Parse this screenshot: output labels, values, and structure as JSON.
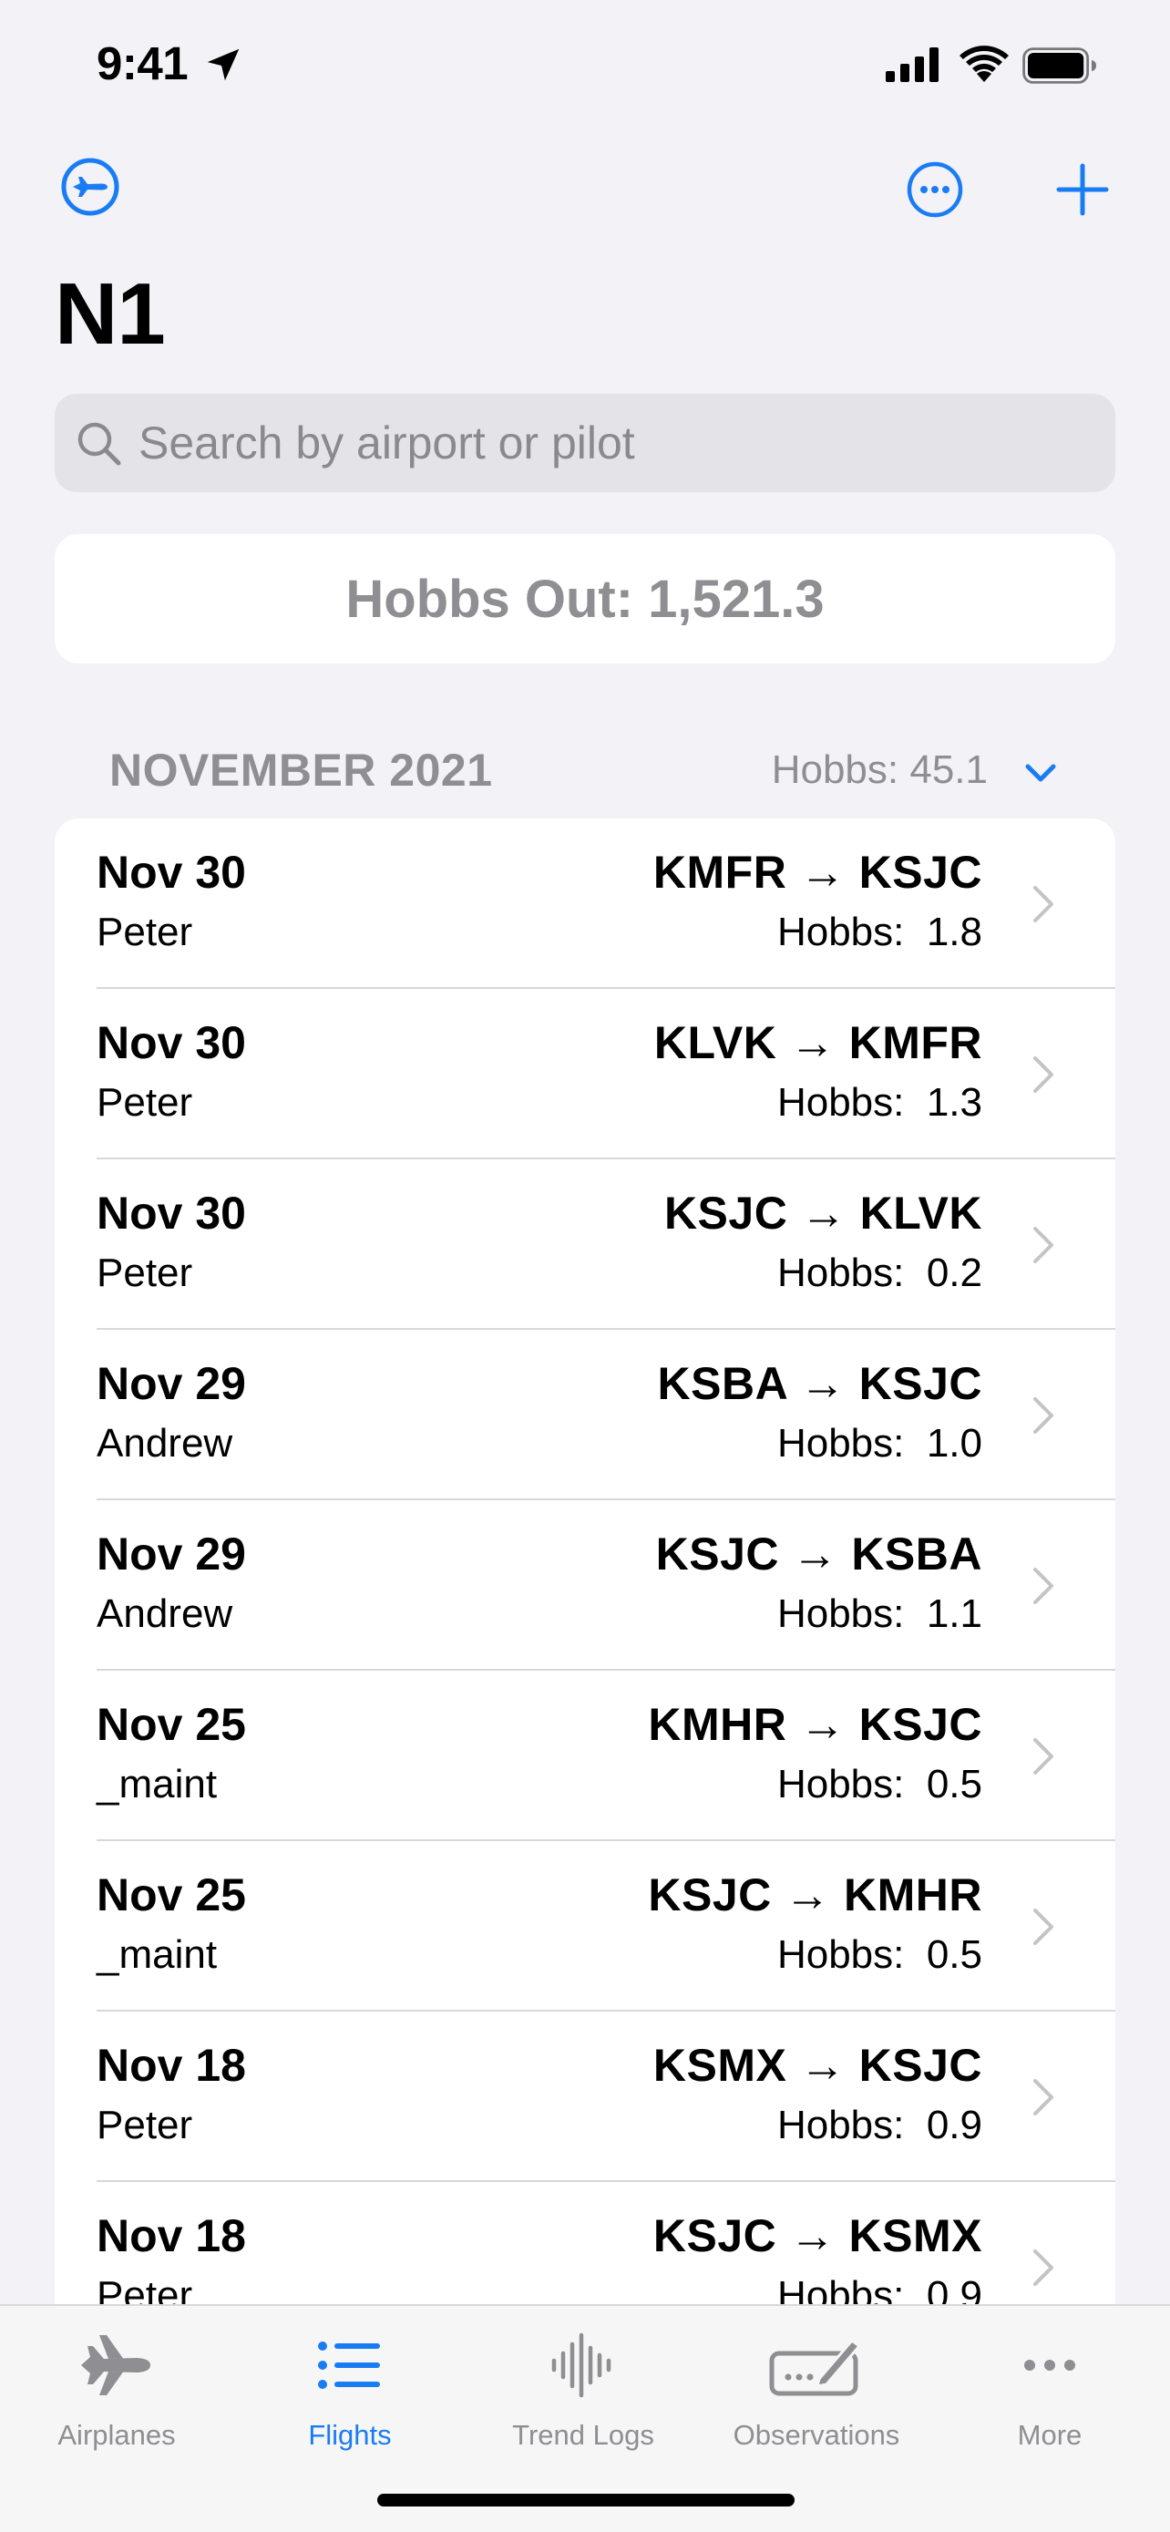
{
  "status_bar": {
    "time": "9:41"
  },
  "colors": {
    "accent": "#1a7cf3",
    "secondary_text": "#8e8e93",
    "background": "#f2f2f7"
  },
  "nav": {
    "title": "N1",
    "left_icon": "airplane-circle-icon",
    "more_icon": "ellipsis-circle-icon",
    "add_icon": "plus-icon"
  },
  "search": {
    "placeholder": "Search by airport or pilot",
    "value": ""
  },
  "hobbs_out": {
    "label": "Hobbs Out: 1,521.3"
  },
  "section": {
    "title": "NOVEMBER 2021",
    "hobbs": "Hobbs: 45.1"
  },
  "flights": [
    {
      "date": "Nov 30",
      "pilot": "Peter",
      "route": "KMFR → KSJC",
      "hobbs": "Hobbs:  1.8"
    },
    {
      "date": "Nov 30",
      "pilot": "Peter",
      "route": "KLVK → KMFR",
      "hobbs": "Hobbs:  1.3"
    },
    {
      "date": "Nov 30",
      "pilot": "Peter",
      "route": "KSJC → KLVK",
      "hobbs": "Hobbs:  0.2"
    },
    {
      "date": "Nov 29",
      "pilot": "Andrew",
      "route": "KSBA → KSJC",
      "hobbs": "Hobbs:  1.0"
    },
    {
      "date": "Nov 29",
      "pilot": "Andrew",
      "route": "KSJC → KSBA",
      "hobbs": "Hobbs:  1.1"
    },
    {
      "date": "Nov 25",
      "pilot": "_maint",
      "route": "KMHR → KSJC",
      "hobbs": "Hobbs:  0.5"
    },
    {
      "date": "Nov 25",
      "pilot": "_maint",
      "route": "KSJC → KMHR",
      "hobbs": "Hobbs:  0.5"
    },
    {
      "date": "Nov 18",
      "pilot": "Peter",
      "route": "KSMX → KSJC",
      "hobbs": "Hobbs:  0.9"
    },
    {
      "date": "Nov 18",
      "pilot": "Peter",
      "route": "KSJC → KSMX",
      "hobbs": "Hobbs:  0.9"
    }
  ],
  "tabs": [
    {
      "label": "Airplanes",
      "icon": "airplane-icon",
      "active": false
    },
    {
      "label": "Flights",
      "icon": "list-icon",
      "active": true
    },
    {
      "label": "Trend Logs",
      "icon": "waveform-icon",
      "active": false
    },
    {
      "label": "Observations",
      "icon": "signature-icon",
      "active": false
    },
    {
      "label": "More",
      "icon": "more-icon",
      "active": false
    }
  ]
}
